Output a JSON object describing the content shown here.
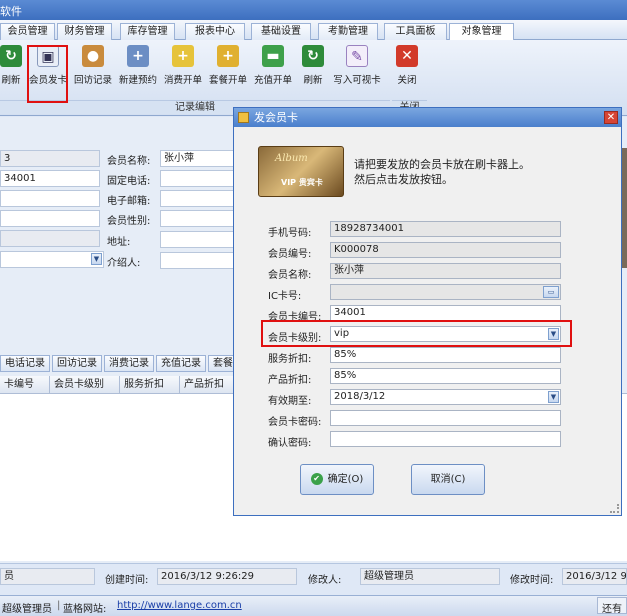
{
  "window": {
    "title": "软件"
  },
  "menu": [
    "会员管理",
    "财务管理",
    "库存管理",
    "报表中心",
    "基础设置",
    "考勤管理",
    "工具面板",
    "对象管理"
  ],
  "toolbar": {
    "buttons": [
      {
        "label": "刷新",
        "icon": "refresh-icon"
      },
      {
        "label": "会员发卡",
        "icon": "member-card-icon"
      },
      {
        "label": "回访记录",
        "icon": "visit-record-icon"
      },
      {
        "label": "新建预约",
        "icon": "new-appointment-icon"
      },
      {
        "label": "消费开单",
        "icon": "consume-order-icon"
      },
      {
        "label": "套餐开单",
        "icon": "package-order-icon"
      },
      {
        "label": "充值开单",
        "icon": "recharge-order-icon"
      },
      {
        "label": "刷新",
        "icon": "refresh-icon"
      },
      {
        "label": "写入可视卡",
        "icon": "write-card-icon"
      },
      {
        "label": "关闭",
        "icon": "close-icon"
      }
    ],
    "group_label": "记录编辑",
    "group_label2": "关闭"
  },
  "form": {
    "member_no_value": "3",
    "member_name_label": "会员名称:",
    "member_name_value": "张小萍",
    "phone_value": "34001",
    "landline_label": "固定电话:",
    "email_label": "电子邮箱:",
    "gender_label": "会员性别:",
    "address_label": "地址:",
    "referrer_label": "介绍人:"
  },
  "tabs": [
    "电话记录",
    "回访记录",
    "消费记录",
    "充值记录",
    "套餐"
  ],
  "table": {
    "columns": [
      "卡编号",
      "会员卡级别",
      "服务折扣",
      "产品折扣"
    ]
  },
  "dialog": {
    "title": "发会员卡",
    "instruction_line1": "请把要发放的会员卡放在刷卡器上。",
    "instruction_line2": "然后点击发放按钮。",
    "card_text": "VIP 贵宾卡",
    "card_script": "Album",
    "fields": [
      {
        "label": "手机号码:",
        "value": "18928734001"
      },
      {
        "label": "会员编号:",
        "value": "K000078"
      },
      {
        "label": "会员名称:",
        "value": "张小萍"
      },
      {
        "label": "IC卡号:",
        "value": ""
      },
      {
        "label": "会员卡编号:",
        "value": "34001"
      },
      {
        "label": "会员卡级别:",
        "value": "vip"
      },
      {
        "label": "服务折扣:",
        "value": "85%"
      },
      {
        "label": "产品折扣:",
        "value": "85%"
      },
      {
        "label": "有效期至:",
        "value": "2018/3/12"
      },
      {
        "label": "会员卡密码:",
        "value": ""
      },
      {
        "label": "确认密码:",
        "value": ""
      }
    ],
    "ok_label": "确定(O)",
    "cancel_label": "取消(C)"
  },
  "status": {
    "left_fragment": "员",
    "created_label": "创建时间:",
    "created_value": "2016/3/12 9:26:29",
    "modifier_label": "修改人:",
    "modifier_value": "超级管理员",
    "modified_label": "修改时间:",
    "modified_value": "2016/3/12 9:"
  },
  "bottom": {
    "user": "超级管理员",
    "site_label": "蓝格网站:",
    "site_url": "http://www.lange.com.cn",
    "right_text": "还有"
  },
  "colors": {
    "highlight": "#e01010",
    "titlebar": "#3d6fbf"
  }
}
